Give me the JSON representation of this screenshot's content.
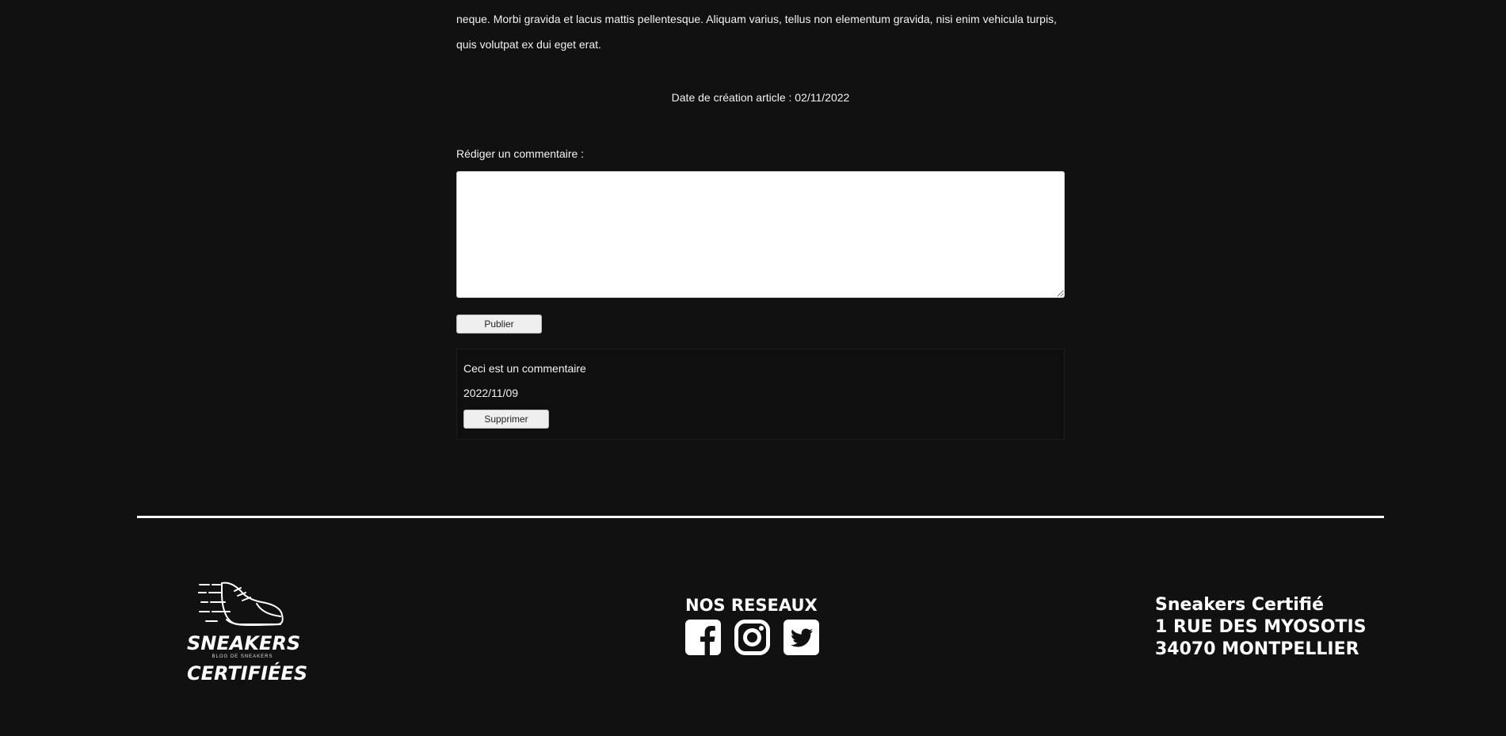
{
  "article": {
    "text_line1": "neque. Morbi gravida et lacus mattis pellentesque. Aliquam varius, tellus non elementum gravida, nisi enim vehicula turpis,",
    "text_line2": "quis volutpat ex dui eget erat.",
    "date": "Date de création article : 02/11/2022"
  },
  "comment_form": {
    "label": "Rédiger un commentaire :",
    "textarea_value": "",
    "publish_label": "Publier"
  },
  "comments": [
    {
      "text": "Ceci est un commentaire",
      "date": "2022/11/09",
      "delete_label": "Supprimer"
    }
  ],
  "footer": {
    "logo": {
      "line1": "SNEAKERS",
      "subtitle": "BLOG DE SNEAKERS",
      "line2": "CERTIFIÉES",
      "icon": "sneaker-icon"
    },
    "networks": {
      "title": "NOS RESEAUX",
      "icons": [
        "facebook-icon",
        "instagram-icon",
        "twitter-icon"
      ]
    },
    "address": {
      "name": "Sneakers Certifié",
      "street": "1 RUE DES MYOSOTIS",
      "city": "34070 MONTPELLIER"
    }
  },
  "colors": {
    "background": "#111111",
    "text": "#ffffff",
    "button": "#efefef"
  }
}
